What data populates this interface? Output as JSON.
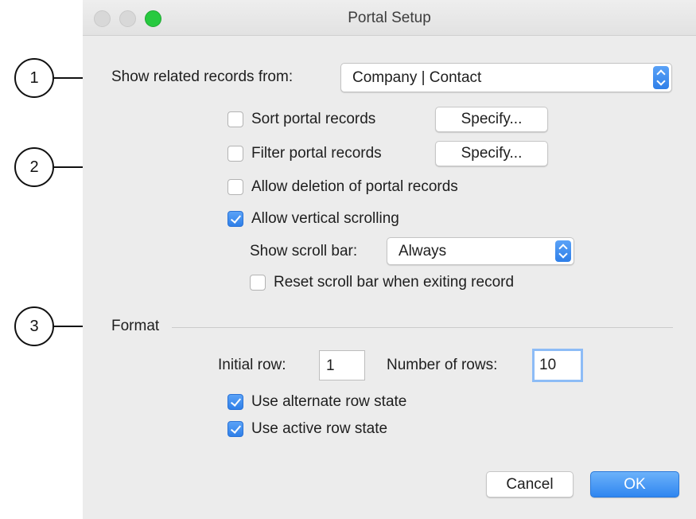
{
  "callouts": [
    "1",
    "2",
    "3"
  ],
  "window": {
    "title": "Portal Setup"
  },
  "related": {
    "label": "Show related records from:",
    "value": "Company | Contact"
  },
  "options": {
    "sort": {
      "label": "Sort portal records",
      "checked": false,
      "button": "Specify..."
    },
    "filter": {
      "label": "Filter portal records",
      "checked": false,
      "button": "Specify..."
    },
    "deletion": {
      "label": "Allow deletion of portal records",
      "checked": false
    },
    "vscroll": {
      "label": "Allow vertical scrolling",
      "checked": true
    },
    "scrollbar": {
      "label": "Show scroll bar:",
      "value": "Always"
    },
    "reset": {
      "label": "Reset scroll bar when exiting record",
      "checked": false
    }
  },
  "format": {
    "heading": "Format",
    "initial_row_label": "Initial row:",
    "initial_row_value": "1",
    "rows_label": "Number of rows:",
    "rows_value": "10",
    "alternate": {
      "label": "Use alternate row state",
      "checked": true
    },
    "active": {
      "label": "Use active row state",
      "checked": true
    }
  },
  "buttons": {
    "cancel": "Cancel",
    "ok": "OK"
  },
  "colors": {
    "accent": "#2f86f0",
    "zoom_button": "#27c93f"
  }
}
